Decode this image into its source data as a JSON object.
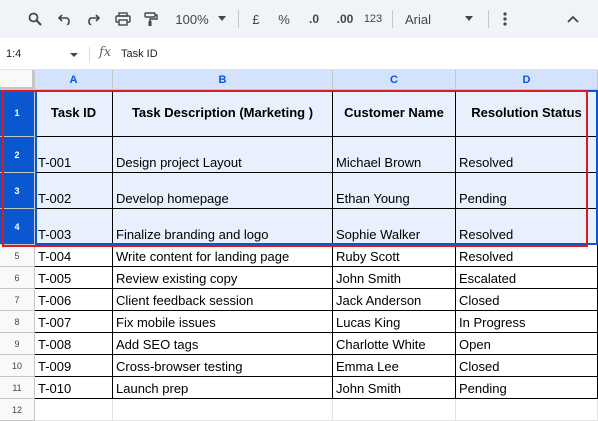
{
  "toolbar": {
    "zoom": "100%",
    "currency": "£",
    "percent": "%",
    "decrease_decimals": ".0",
    "increase_decimals": ".00",
    "number_format": "123",
    "font": "Arial"
  },
  "formula_bar": {
    "name_box": "1:4",
    "fx": "fx",
    "content": "Task ID"
  },
  "columns": [
    "A",
    "B",
    "C",
    "D"
  ],
  "rows": [
    {
      "num": "1",
      "cells": [
        "Task ID",
        "Task Description (Marketing )",
        "Customer  Name",
        "Resolution Status"
      ]
    },
    {
      "num": "2",
      "cells": [
        "T-001",
        "Design project Layout",
        "Michael Brown",
        "Resolved"
      ]
    },
    {
      "num": "3",
      "cells": [
        "T-002",
        "Develop homepage",
        "Ethan Young",
        "Pending"
      ]
    },
    {
      "num": "4",
      "cells": [
        "T-003",
        "Finalize branding and logo",
        "Sophie Walker",
        "Resolved"
      ]
    },
    {
      "num": "5",
      "cells": [
        "T-004",
        "Write content for landing page",
        "Ruby Scott",
        "Resolved"
      ]
    },
    {
      "num": "6",
      "cells": [
        "T-005",
        "Review existing copy",
        "John Smith",
        "Escalated"
      ]
    },
    {
      "num": "7",
      "cells": [
        "T-006",
        "Client feedback session",
        "Jack Anderson",
        "Closed"
      ]
    },
    {
      "num": "8",
      "cells": [
        "T-007",
        "Fix mobile issues",
        "Lucas King",
        "In Progress"
      ]
    },
    {
      "num": "9",
      "cells": [
        "T-008",
        "Add SEO tags",
        "Charlotte White",
        "Open"
      ]
    },
    {
      "num": "10",
      "cells": [
        "T-009",
        "Cross-browser testing",
        "Emma Lee",
        "Closed"
      ]
    },
    {
      "num": "11",
      "cells": [
        "T-010",
        "Launch prep",
        "John Smith",
        "Pending"
      ]
    },
    {
      "num": "12",
      "cells": [
        "",
        "",
        "",
        ""
      ]
    }
  ],
  "selected_rows": [
    "1",
    "2",
    "3",
    "4"
  ],
  "colors": {
    "selection": "#0b57d0",
    "selection_fill": "#e8f0fd",
    "highlight_box": "#e0191c"
  }
}
